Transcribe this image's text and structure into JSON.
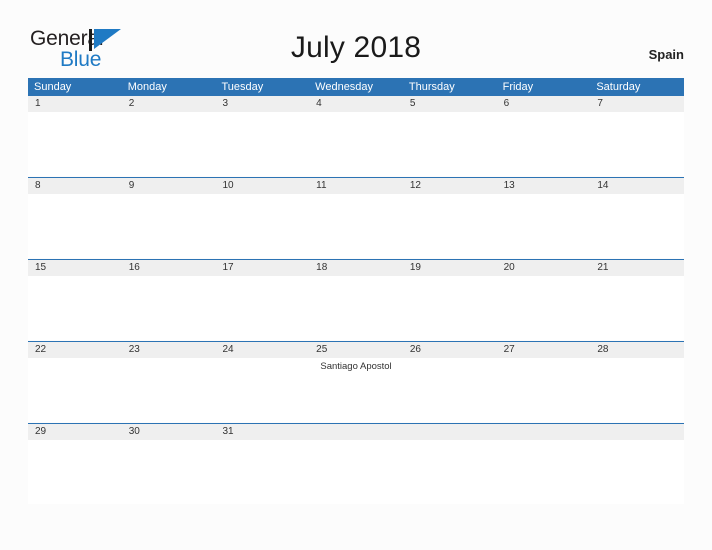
{
  "brand": {
    "line1": "General",
    "line2": "Blue",
    "mark_icon": "triangle-flag-icon",
    "line2_color": "#1f7ac4"
  },
  "header": {
    "title": "July 2018",
    "region": "Spain"
  },
  "colors": {
    "header_blue": "#2c73b4",
    "date_bar_gray": "#efefef",
    "page_background": "#fcfcfc",
    "separator_blue": "#2c73b4"
  },
  "calendar": {
    "weekdays": [
      "Sunday",
      "Monday",
      "Tuesday",
      "Wednesday",
      "Thursday",
      "Friday",
      "Saturday"
    ],
    "weeks": [
      {
        "days": [
          {
            "date": "1",
            "events": []
          },
          {
            "date": "2",
            "events": []
          },
          {
            "date": "3",
            "events": []
          },
          {
            "date": "4",
            "events": []
          },
          {
            "date": "5",
            "events": []
          },
          {
            "date": "6",
            "events": []
          },
          {
            "date": "7",
            "events": []
          }
        ]
      },
      {
        "days": [
          {
            "date": "8",
            "events": []
          },
          {
            "date": "9",
            "events": []
          },
          {
            "date": "10",
            "events": []
          },
          {
            "date": "11",
            "events": []
          },
          {
            "date": "12",
            "events": []
          },
          {
            "date": "13",
            "events": []
          },
          {
            "date": "14",
            "events": []
          }
        ]
      },
      {
        "days": [
          {
            "date": "15",
            "events": []
          },
          {
            "date": "16",
            "events": []
          },
          {
            "date": "17",
            "events": []
          },
          {
            "date": "18",
            "events": []
          },
          {
            "date": "19",
            "events": []
          },
          {
            "date": "20",
            "events": []
          },
          {
            "date": "21",
            "events": []
          }
        ]
      },
      {
        "days": [
          {
            "date": "22",
            "events": []
          },
          {
            "date": "23",
            "events": []
          },
          {
            "date": "24",
            "events": []
          },
          {
            "date": "25",
            "events": [
              "Santiago Apostol"
            ]
          },
          {
            "date": "26",
            "events": []
          },
          {
            "date": "27",
            "events": []
          },
          {
            "date": "28",
            "events": []
          }
        ]
      },
      {
        "days": [
          {
            "date": "29",
            "events": []
          },
          {
            "date": "30",
            "events": []
          },
          {
            "date": "31",
            "events": []
          },
          {
            "date": "",
            "events": []
          },
          {
            "date": "",
            "events": []
          },
          {
            "date": "",
            "events": []
          },
          {
            "date": "",
            "events": []
          }
        ]
      }
    ]
  }
}
